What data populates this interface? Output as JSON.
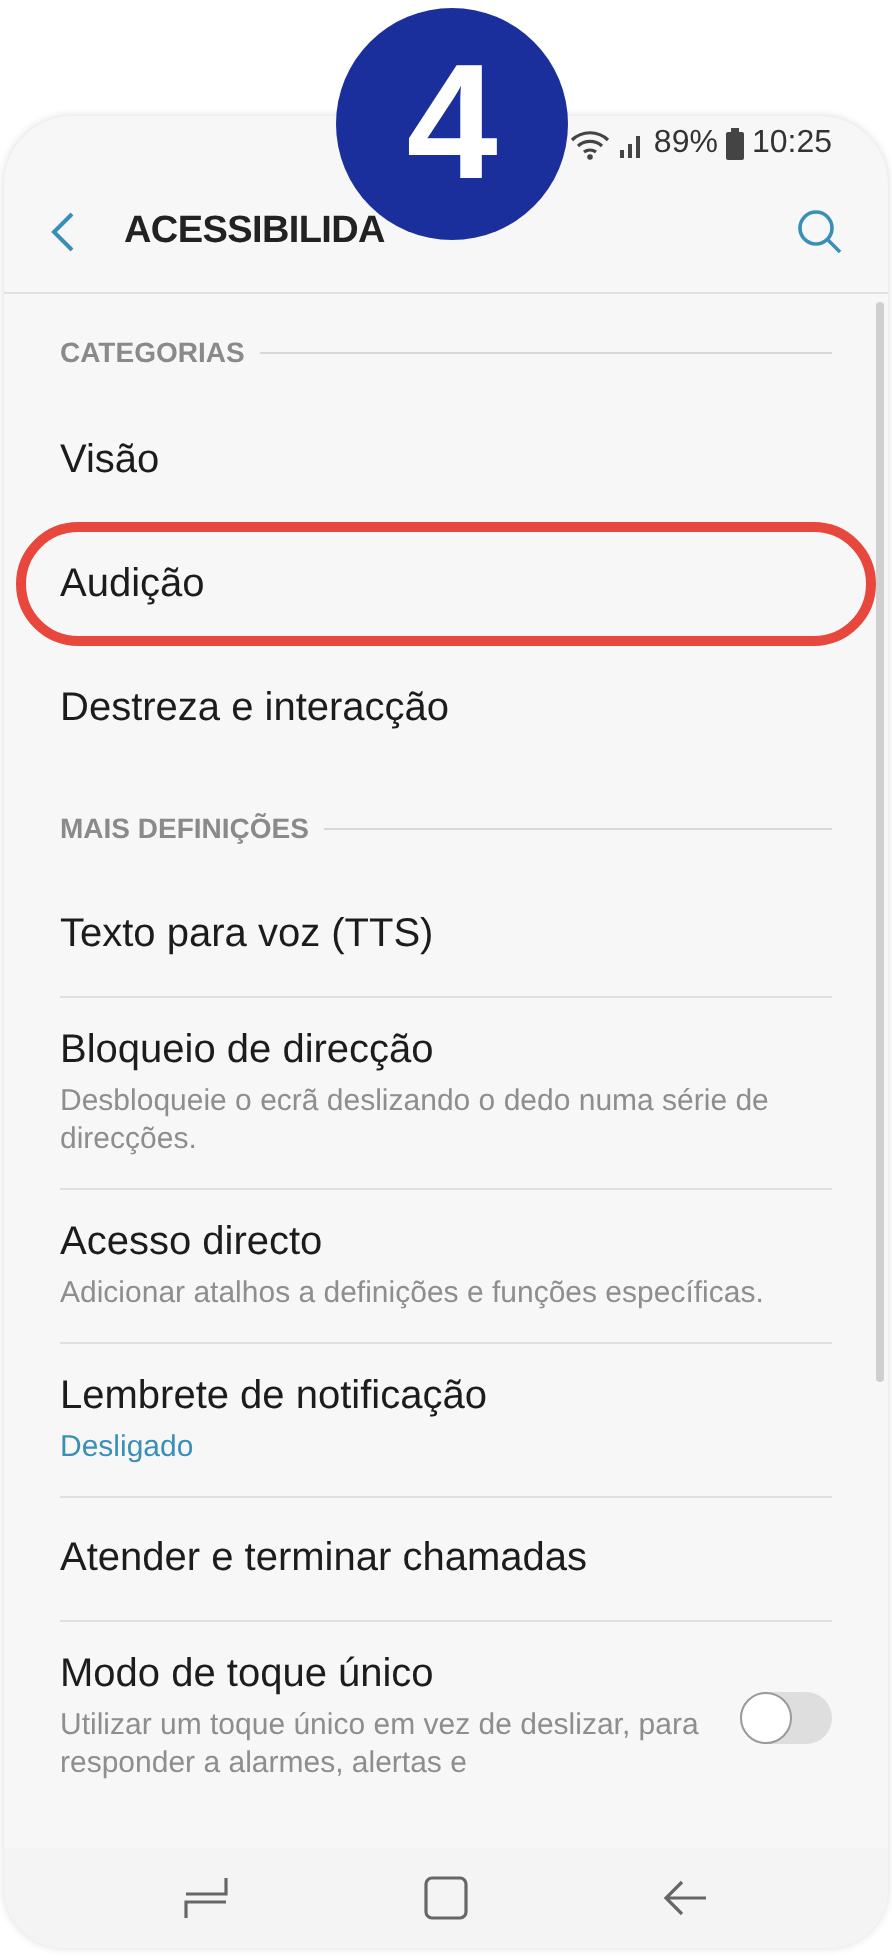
{
  "badge": "4",
  "status_bar": {
    "battery": "89%",
    "time": "10:25"
  },
  "header": {
    "title": "ACESSIBILIDA"
  },
  "sections": [
    {
      "heading": "CATEGORIAS",
      "dividers": false,
      "items": [
        {
          "title": "Visão",
          "highlighted": false
        },
        {
          "title": "Audição",
          "highlighted": true
        },
        {
          "title": "Destreza e interacção",
          "highlighted": false
        }
      ]
    },
    {
      "heading": "MAIS DEFINIÇÕES",
      "dividers": true,
      "items": [
        {
          "title": "Texto para voz (TTS)",
          "highlighted": false
        },
        {
          "title": "Bloqueio de direcção",
          "subtitle": "Desbloqueie o ecrã deslizando o dedo numa série de direcções.",
          "highlighted": false
        },
        {
          "title": "Acesso directo",
          "subtitle": "Adicionar atalhos a definições e funções específicas.",
          "highlighted": false
        },
        {
          "title": "Lembrete de notificação",
          "status": "Desligado",
          "highlighted": false
        },
        {
          "title": "Atender e terminar chamadas",
          "highlighted": false
        },
        {
          "title": "Modo de toque único",
          "subtitle": "Utilizar um toque único em vez de deslizar, para responder a alarmes, alertas e",
          "highlighted": false,
          "toggle": {
            "on": false
          }
        }
      ]
    }
  ]
}
